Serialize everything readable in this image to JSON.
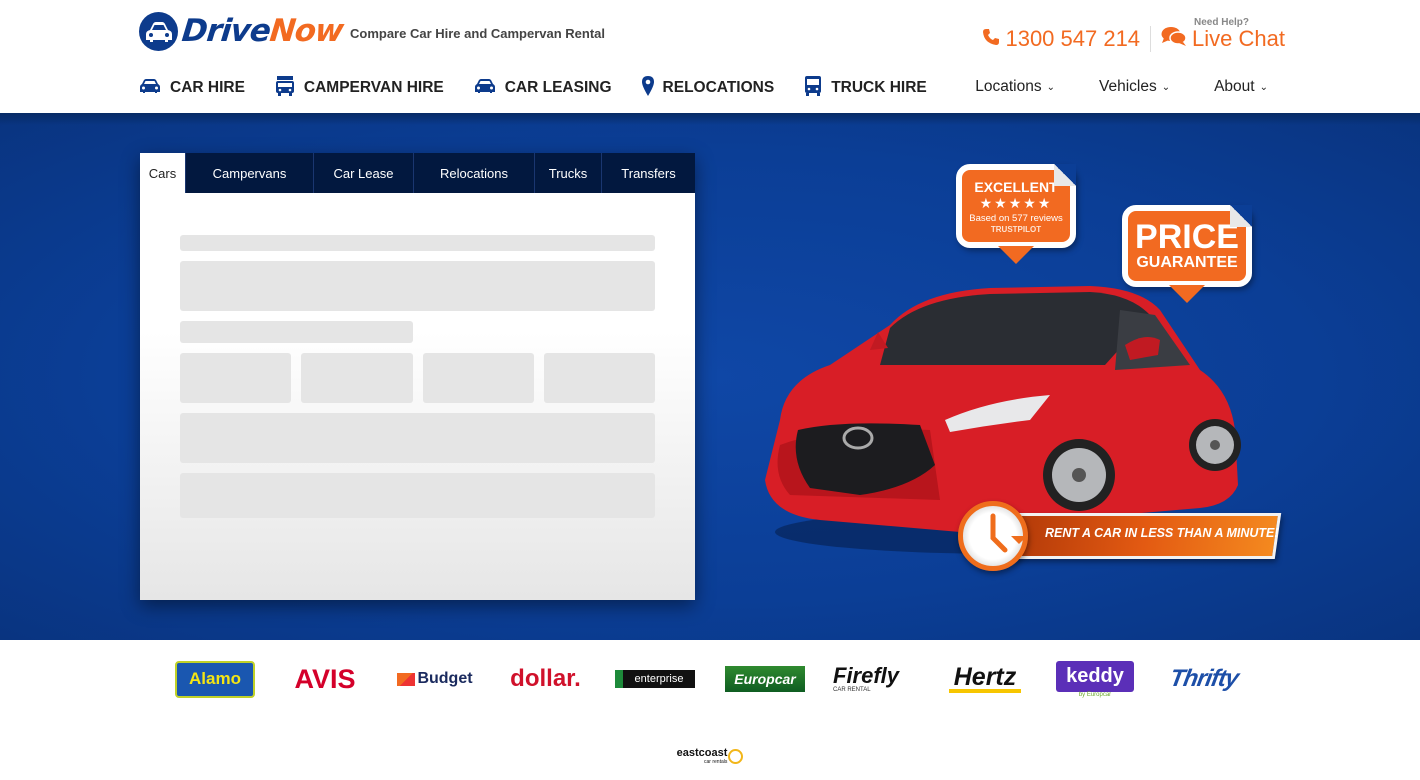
{
  "header": {
    "logo": {
      "drive": "Drive",
      "now": "Now"
    },
    "tagline": "Compare Car Hire and Campervan Rental",
    "phone": "1300 547 214",
    "need_help": "Need Help?",
    "live_chat": "Live Chat",
    "main_nav": [
      {
        "label": "CAR HIRE",
        "icon": "car-icon"
      },
      {
        "label": "CAMPERVAN HIRE",
        "icon": "campervan-icon"
      },
      {
        "label": "CAR LEASING",
        "icon": "car-icon"
      },
      {
        "label": "RELOCATIONS",
        "icon": "map-marker-icon"
      },
      {
        "label": "TRUCK HIRE",
        "icon": "truck-icon"
      }
    ],
    "sub_nav": [
      {
        "label": "Locations"
      },
      {
        "label": "Vehicles"
      },
      {
        "label": "About"
      }
    ]
  },
  "search": {
    "tabs": [
      {
        "label": "Cars",
        "active": true
      },
      {
        "label": "Campervans",
        "active": false
      },
      {
        "label": "Car Lease",
        "active": false
      },
      {
        "label": "Relocations",
        "active": false
      },
      {
        "label": "Trucks",
        "active": false
      },
      {
        "label": "Transfers",
        "active": false
      }
    ],
    "state": "loading"
  },
  "promo": {
    "rating": {
      "title": "EXCELLENT",
      "stars": "★★★★★",
      "star_count": 5,
      "reviews": "Based on 577 reviews",
      "source": "TRUSTPILOT"
    },
    "price": {
      "line1": "PRICE",
      "line2": "GUARANTEE"
    },
    "banner": "RENT A CAR IN LESS THAN A MINUTE!"
  },
  "brands": [
    {
      "name": "Alamo"
    },
    {
      "name": "AVIS"
    },
    {
      "name": "Budget"
    },
    {
      "name": "dollar."
    },
    {
      "name": "enterprise"
    },
    {
      "name": "Europcar"
    },
    {
      "name": "Firefly",
      "sub": "CAR RENTAL"
    },
    {
      "name": "Hertz"
    },
    {
      "name": "keddy",
      "sub": "by Europcar"
    },
    {
      "name": "Thrifty"
    },
    {
      "name": "eastcoast",
      "sub": "car rentals"
    }
  ],
  "colors": {
    "brand_blue": "#0d3b8c",
    "brand_orange": "#f26a21",
    "hero_blue": "#0b3e96",
    "tab_bar": "#02183f"
  }
}
